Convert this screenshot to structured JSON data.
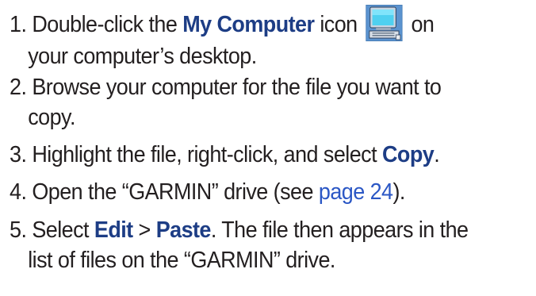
{
  "steps": [
    {
      "num": "1.",
      "before": "Double-click the",
      "bold1": "My Computer",
      "after_bold1": "icon",
      "icon": "my-computer-icon",
      "after_icon": "on",
      "line2": "your computer’s desktop."
    },
    {
      "num": "2.",
      "line1": "Browse your computer for the file you want to",
      "line2": "copy."
    },
    {
      "num": "3.",
      "before": "Highlight the file, right-click, and select",
      "bold1": "Copy",
      "after": "."
    },
    {
      "num": "4.",
      "before": "Open the “GARMIN” drive (see",
      "link": "page 24",
      "after": ")."
    },
    {
      "num": "5.",
      "before": "Select",
      "bold1": "Edit",
      "sep": ">",
      "bold2": "Paste",
      "after": ". The file then appears in the",
      "line2": "list of files on the “GARMIN” drive."
    }
  ],
  "colors": {
    "text": "#231f20",
    "bold": "#1d3d85",
    "link": "#2b57c5"
  }
}
